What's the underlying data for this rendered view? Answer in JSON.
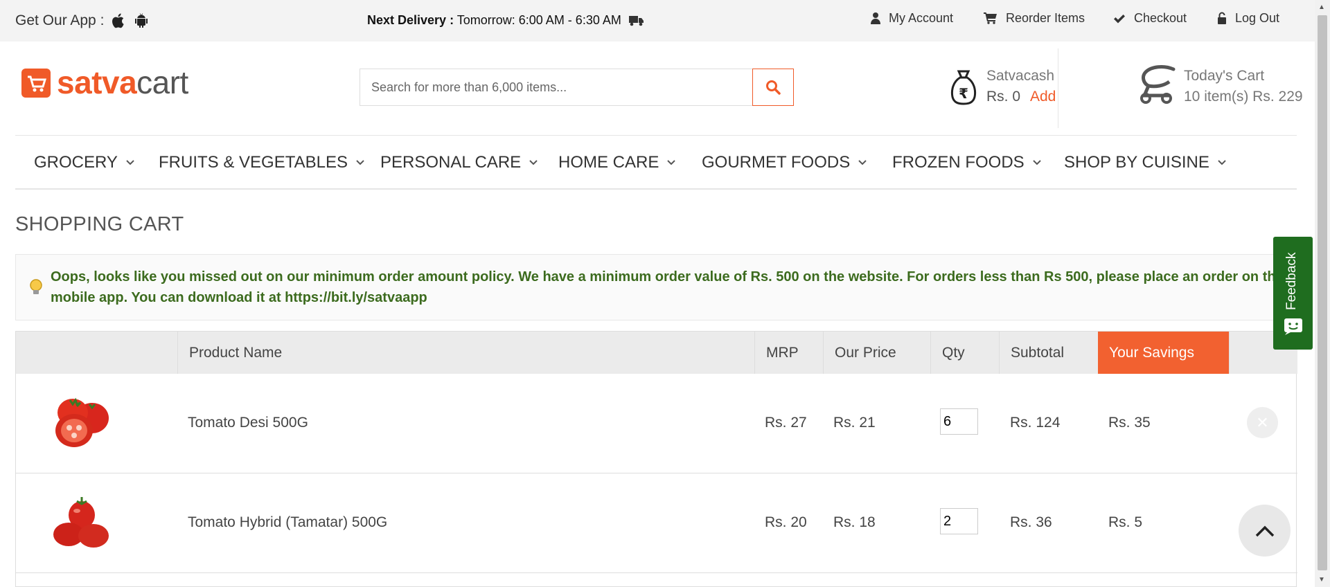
{
  "topbar": {
    "app_label": "Get Our App :",
    "delivery_label": "Next Delivery :",
    "delivery_time": "Tomorrow: 6:00 AM - 6:30 AM",
    "links": [
      "My Account",
      "Reorder Items",
      "Checkout",
      "Log Out"
    ]
  },
  "header": {
    "logo_part1": "satva",
    "logo_part2": "cart",
    "search_placeholder": "Search for more than 6,000 items...",
    "satvacash_title": "Satvacash",
    "satvacash_value": "Rs. 0",
    "satvacash_add": "Add",
    "cart_title": "Today's Cart",
    "cart_summary": "10 item(s) Rs. 229"
  },
  "nav": [
    "GROCERY",
    "FRUITS & VEGETABLES",
    "PERSONAL CARE",
    "HOME CARE",
    "GOURMET FOODS",
    "FROZEN FOODS",
    "SHOP BY CUISINE"
  ],
  "page_title": "SHOPPING CART",
  "notice": "Oops, looks like you missed out on our minimum order amount policy. We have a minimum order value of Rs. 500 on the website. For orders less than Rs 500, please place an order on the mobile app. You can download it at https://bit.ly/satvaapp",
  "table": {
    "headers": [
      "Product Name",
      "MRP",
      "Our Price",
      "Qty",
      "Subtotal",
      "Your Savings"
    ],
    "rows": [
      {
        "name": "Tomato Desi 500G",
        "mrp": "Rs. 27",
        "price": "Rs. 21",
        "qty": "6",
        "subtotal": "Rs. 124",
        "savings": "Rs. 35"
      },
      {
        "name": "Tomato Hybrid (Tamatar) 500G",
        "mrp": "Rs. 20",
        "price": "Rs. 18",
        "qty": "2",
        "subtotal": "Rs. 36",
        "savings": "Rs. 5"
      }
    ]
  },
  "feedback_label": "Feedback",
  "colors": {
    "accent": "#f05a28",
    "notice_text": "#3c6b1e",
    "feedback_bg": "#1f6d1f"
  }
}
